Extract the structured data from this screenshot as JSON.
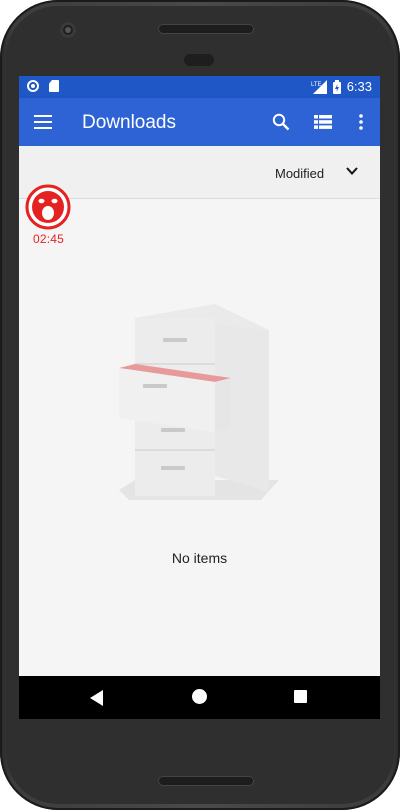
{
  "status_bar": {
    "network_label": "LTE",
    "time": "6:33"
  },
  "app_bar": {
    "title": "Downloads",
    "icons": [
      "menu-icon",
      "search-icon",
      "list-view-icon",
      "more-vert-icon"
    ]
  },
  "sort": {
    "label": "Modified",
    "icon": "chevron-down-icon"
  },
  "recorder": {
    "timer": "02:45",
    "color": "#e52222"
  },
  "empty_state": {
    "message": "No items",
    "icon": "filing-cabinet-icon"
  },
  "colors": {
    "status_bar": "#1f57c6",
    "app_bar": "#2d63d4",
    "background": "#f5f5f5"
  }
}
